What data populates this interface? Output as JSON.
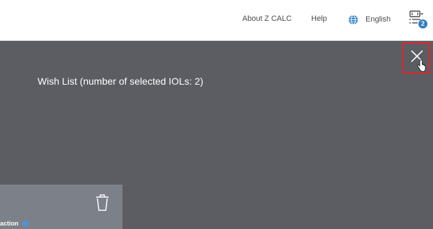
{
  "header": {
    "about_label": "About Z CALC",
    "help_label": "Help",
    "language_label": "English",
    "language_icon": "globe-icon",
    "wishlist_icon": "wish-list-icon",
    "wishlist_count": "2"
  },
  "overlay": {
    "title": "Wish List (number of selected IOLs: 2)",
    "close_icon": "close-icon"
  },
  "card": {
    "label": "action",
    "delete_icon": "trash-icon",
    "info_icon": "info-icon"
  },
  "colors": {
    "overlay_bg": "#5b5d63",
    "card_bg": "#7c8088",
    "accent": "#2f7fc4",
    "highlight": "#e0262b"
  }
}
